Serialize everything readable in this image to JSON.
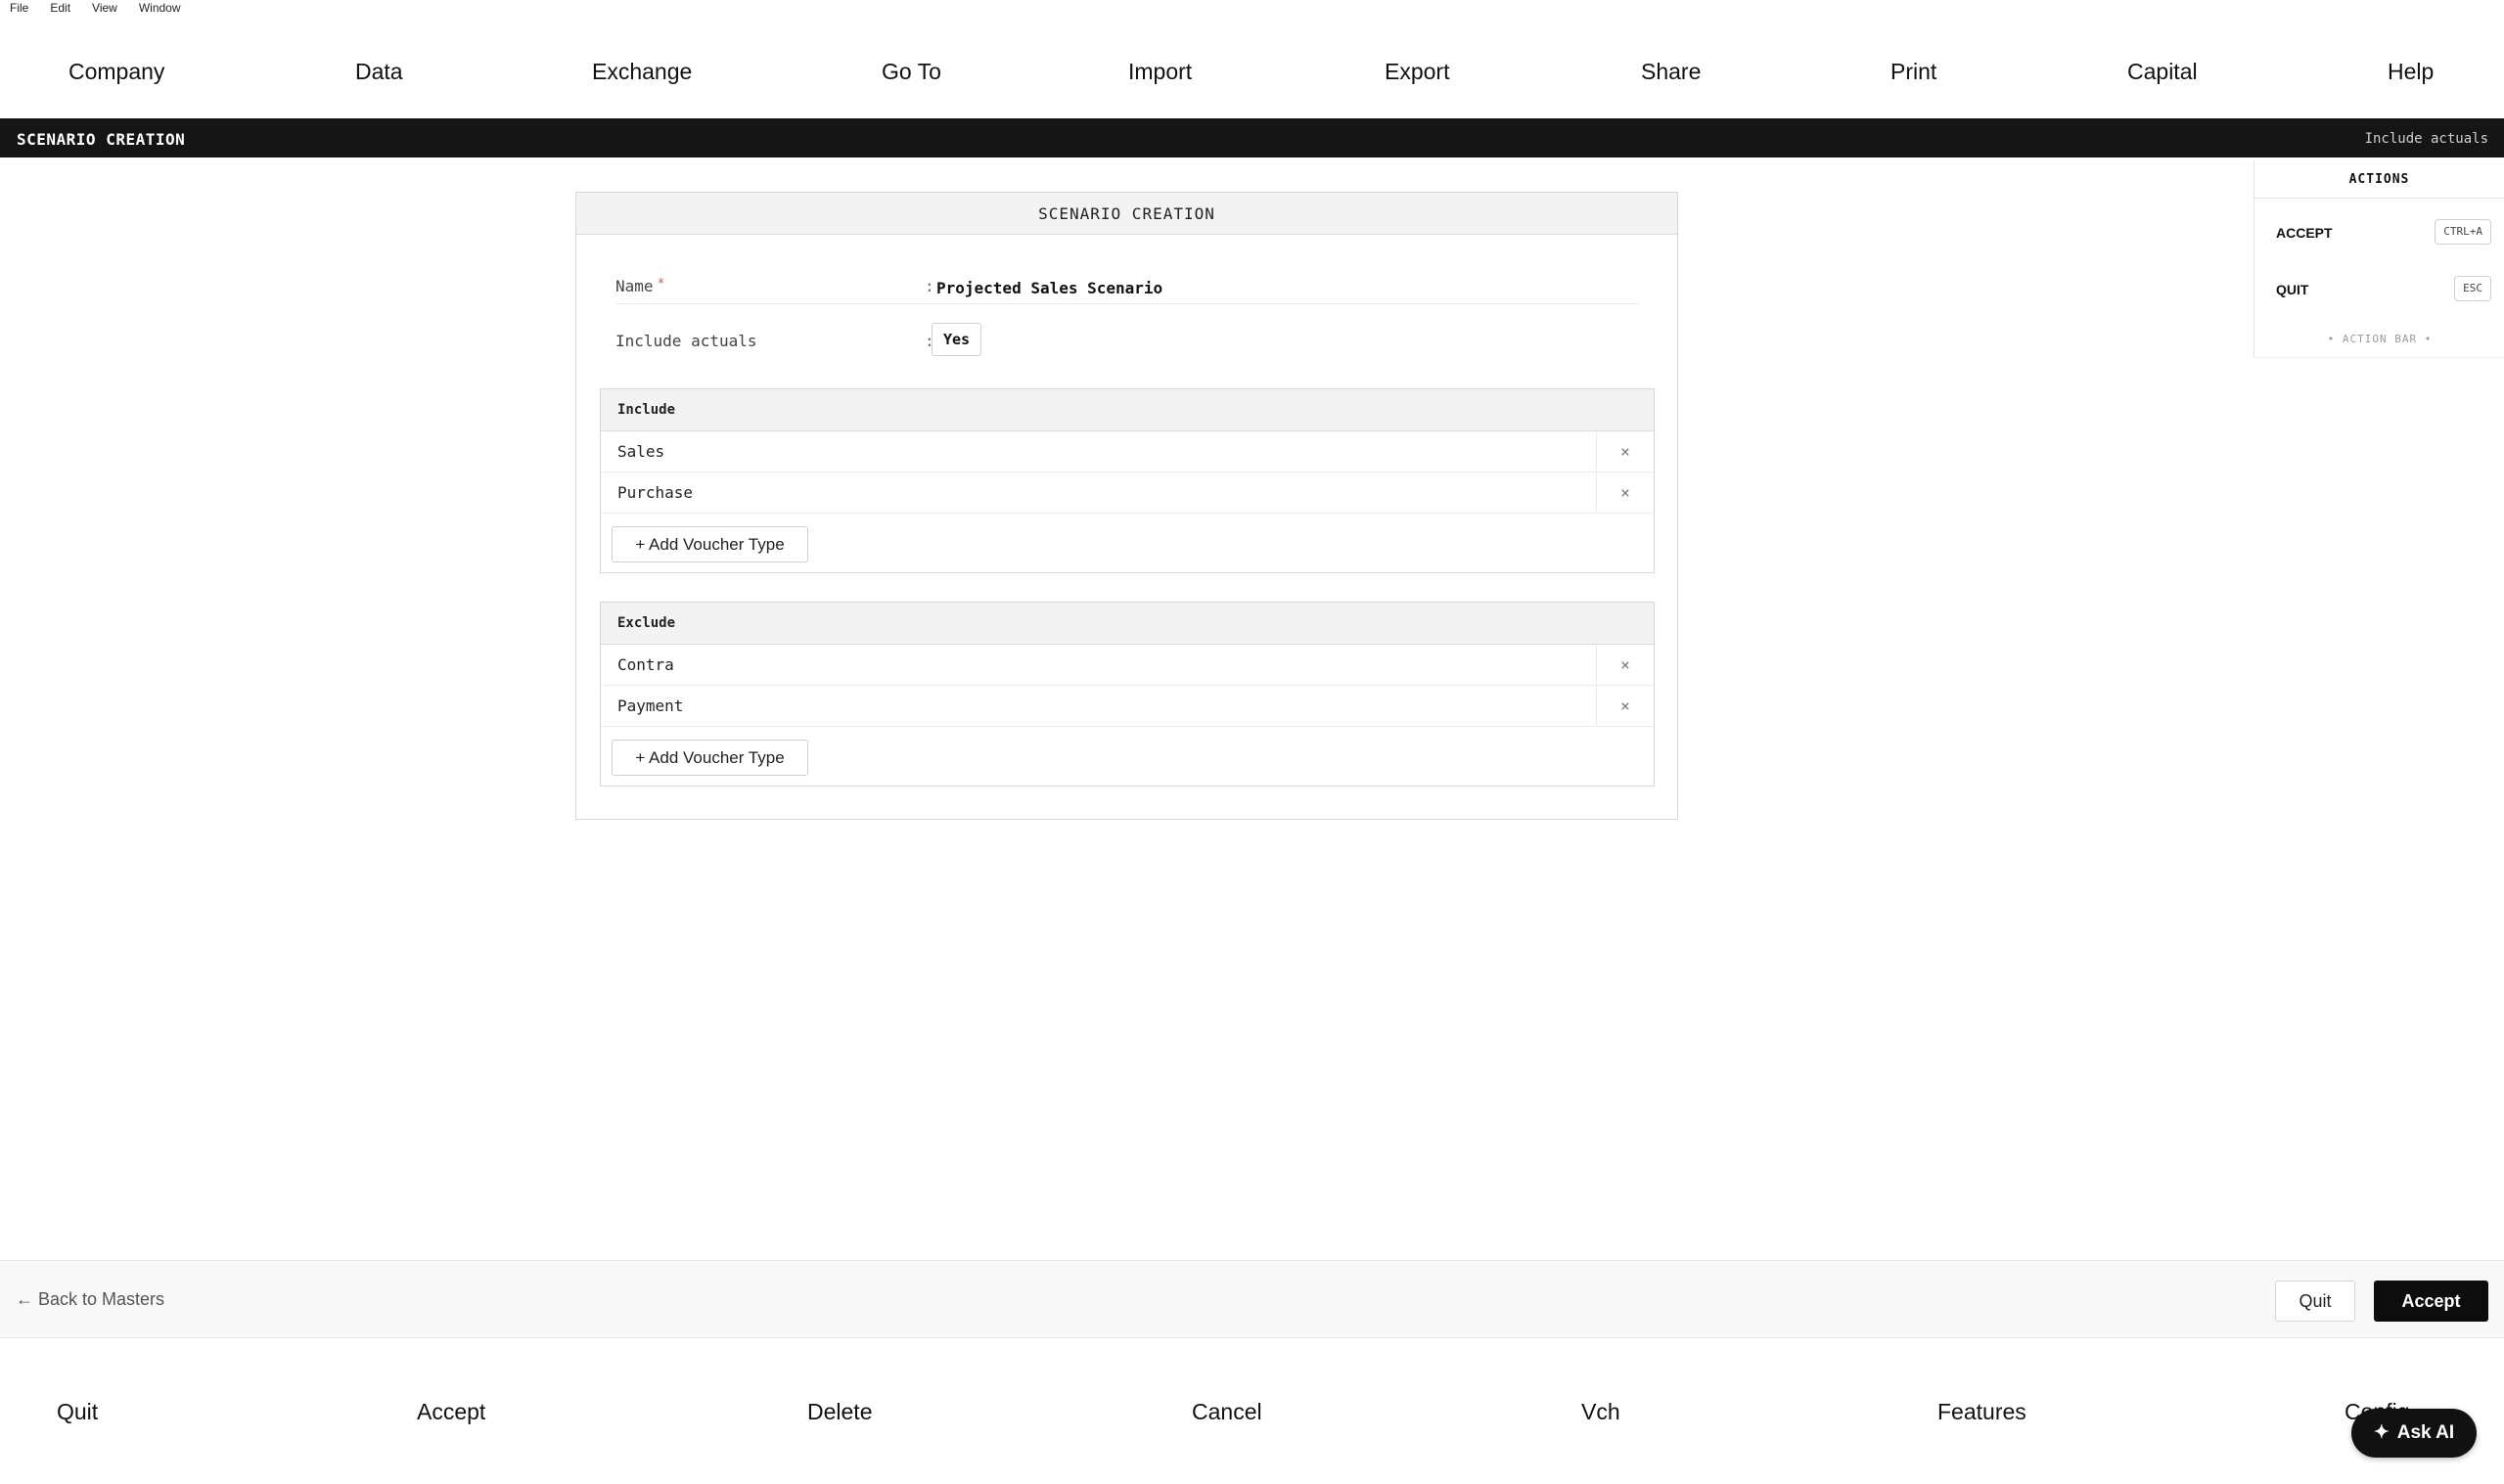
{
  "os_menu": [
    "File",
    "Edit",
    "View",
    "Window"
  ],
  "top_nav": [
    "Company",
    "Data",
    "Exchange",
    "Go To",
    "Import",
    "Export",
    "Share",
    "Print",
    "Capital",
    "Help"
  ],
  "title_bar": {
    "left": "SCENARIO CREATION",
    "right": "Include actuals"
  },
  "form": {
    "heading": "SCENARIO CREATION",
    "name_label": "Name",
    "required_mark": "*",
    "colon": ":",
    "name_value": "Projected Sales Scenario",
    "include_actuals_label": "Include actuals",
    "include_actuals_value": "Yes",
    "include": {
      "heading": "Include",
      "items": [
        "Sales",
        "Purchase"
      ],
      "add_label": "+ Add Voucher Type"
    },
    "exclude": {
      "heading": "Exclude",
      "items": [
        "Contra",
        "Payment"
      ],
      "add_label": "+ Add Voucher Type"
    },
    "remove_glyph": "×"
  },
  "actions_panel": {
    "heading": "ACTIONS",
    "items": [
      {
        "label": "ACCEPT",
        "shortcut": "CTRL+A"
      },
      {
        "label": "QUIT",
        "shortcut": "ESC"
      }
    ],
    "footer": "• ACTION BAR •"
  },
  "bottom_bar": {
    "back": "← Back to Masters",
    "quit": "Quit",
    "accept": "Accept"
  },
  "function_keys": [
    "Quit",
    "Accept",
    "Delete",
    "Cancel",
    "Vch",
    "Features",
    "Config"
  ],
  "ask_ai": {
    "icon": "✦",
    "label": "Ask AI"
  }
}
